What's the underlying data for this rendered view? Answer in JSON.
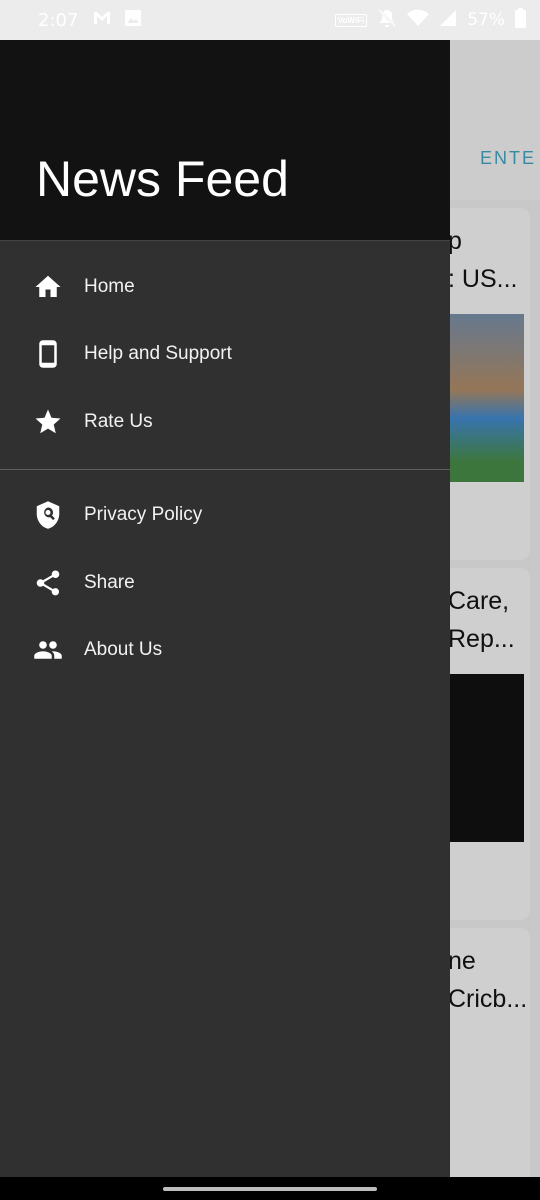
{
  "status_bar": {
    "time": "2:07",
    "battery": "57%",
    "vowifi_label": "Vo\nWiFi",
    "icons": [
      "gmail-icon",
      "image-icon",
      "vowifi-icon",
      "mute-icon",
      "wifi-icon",
      "signal-icon",
      "battery-icon"
    ]
  },
  "background": {
    "tab_label": "ENTE",
    "cards": [
      {
        "title": "p\n: US..."
      },
      {
        "title": "Care,\nRep..."
      },
      {
        "title": "ne\nCricb..."
      }
    ]
  },
  "drawer": {
    "title": "News Feed",
    "primary_items": [
      {
        "label": "Home",
        "icon": "home-icon"
      },
      {
        "label": "Help and Support",
        "icon": "phone-icon"
      },
      {
        "label": "Rate Us",
        "icon": "star-icon"
      }
    ],
    "secondary_items": [
      {
        "label": "Privacy Policy",
        "icon": "privacy-shield-icon"
      },
      {
        "label": "Share",
        "icon": "share-icon"
      },
      {
        "label": "About Us",
        "icon": "people-icon"
      }
    ]
  },
  "colors": {
    "drawer_background": "#303030",
    "header_background": "#121212",
    "tab_accent": "#3a8fa8"
  }
}
